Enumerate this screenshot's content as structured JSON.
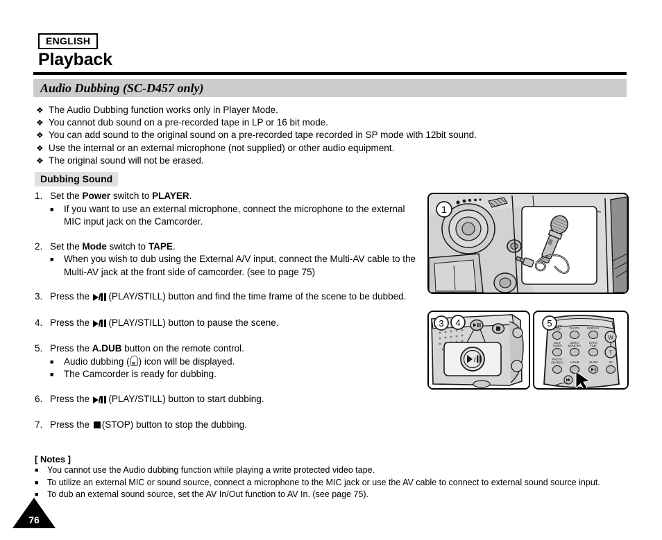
{
  "header": {
    "language_badge": "ENGLISH",
    "title": "Playback",
    "section_title": "Audio Dubbing (SC-D457 only)"
  },
  "intro_bullets": [
    {
      "marker": "❖",
      "text": "The Audio Dubbing function works only in Player Mode."
    },
    {
      "marker": "❖",
      "text": "You cannot dub sound on a pre-recorded tape in LP or 16 bit mode."
    },
    {
      "marker": "❖",
      "text": "You can add sound to the original sound on a pre-recorded tape recorded in SP mode with 12bit sound."
    },
    {
      "marker": "❖",
      "text": "Use the internal or an external microphone (not supplied) or other audio equipment."
    },
    {
      "marker": "❖",
      "text": "The original sound will not be erased."
    }
  ],
  "subhead": "Dubbing Sound",
  "steps": [
    {
      "num": "1.",
      "text_parts": [
        "Set the ",
        "Power",
        " switch to ",
        "PLAYER",
        "."
      ],
      "subs": [
        "If you want to use an external microphone, connect the microphone to the external MIC input jack on the Camcorder."
      ]
    },
    {
      "num": "2.",
      "text_parts": [
        "Set the ",
        "Mode",
        " switch to ",
        "TAPE",
        "."
      ],
      "subs": [
        "When you wish to dub using the External A/V input, connect the Multi-AV cable to the Multi-AV jack at the front side of camcorder. (see to page 75)"
      ]
    },
    {
      "num": "3.",
      "text_before": "Press the ",
      "icon": "play-still-icon",
      "text_after": "(PLAY/STILL) button and find the time frame of the scene to be dubbed.",
      "subs": []
    },
    {
      "num": "4.",
      "text_before": "Press the ",
      "icon": "play-still-icon",
      "text_after": "(PLAY/STILL) button to pause the scene.",
      "subs": []
    },
    {
      "num": "5.",
      "text_parts": [
        "Press the ",
        "A.DUB",
        " button on the remote control."
      ],
      "subs_rich": [
        {
          "before": "Audio dubbing (",
          "icon": "audio-dub-icon",
          "after": ") icon will be displayed."
        },
        {
          "before": "The Camcorder is ready for dubbing.",
          "icon": "",
          "after": ""
        }
      ]
    },
    {
      "num": "6.",
      "text_before": "Press the ",
      "icon": "play-still-icon",
      "text_after": "(PLAY/STILL) button to start dubbing.",
      "subs": []
    },
    {
      "num": "7.",
      "text_before": "Press the ",
      "icon": "stop-icon",
      "text_after": "(STOP) button to stop the dubbing.",
      "subs": []
    }
  ],
  "notes": {
    "title": "[ Notes ]",
    "items": [
      "You cannot use the Audio dubbing function while playing a write protected video tape.",
      "To utilize an external MIC or sound source, connect a microphone to the MIC jack or use the AV cable to connect to external sound source input.",
      "To dub an external sound source, set the AV In/Out function to AV In. (see page 75)."
    ]
  },
  "page_number": "76",
  "figures": [
    {
      "id": "fig1",
      "callout": "1",
      "caption_elements": [
        "camcorder-front-view",
        "external-microphone",
        "microphone-cable",
        "mic-input-jack"
      ]
    },
    {
      "id": "fig2",
      "callouts": [
        "3",
        "4"
      ],
      "caption_elements": [
        "camcorder-side-buttons",
        "play-still-button",
        "stop-button",
        "speaker-grille"
      ]
    },
    {
      "id": "fig3",
      "callout": "5",
      "remote_buttons": [
        "START/ STOP",
        "PHOTO",
        "DISPLAY",
        "SELF TIMER",
        "ZERO MEMORY",
        "DATE/ TIME",
        "PHOTO SEARCH",
        "A.DUB",
        "SLOW",
        "X2",
        "W",
        "T"
      ]
    }
  ],
  "colors": {
    "section_bar": "#cccccc",
    "subhead_bg": "#e0e0e0",
    "text": "#000000",
    "figure_fill": "#d8d8d8"
  }
}
